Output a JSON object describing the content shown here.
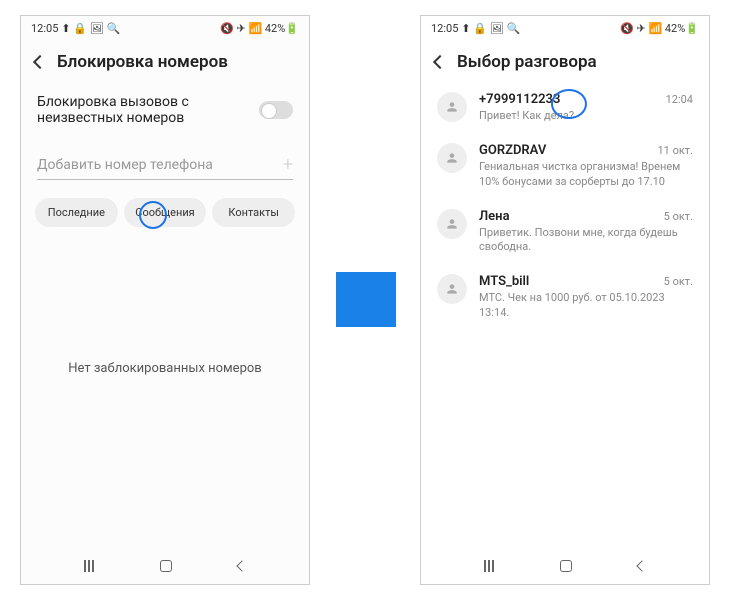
{
  "status": {
    "time": "12:05",
    "left_icons": "⬆ 🔒 🖼 🔍",
    "right_icons": "🔇 ✈ 📶 42%🔋"
  },
  "left": {
    "title": "Блокировка номеров",
    "toggle_label_1": "Блокировка вызовов с",
    "toggle_label_2": "неизвестных номеров",
    "input_placeholder": "Добавить номер телефона",
    "chips": {
      "recent": "Последние",
      "messages": "Сообщения",
      "contacts": "Контакты"
    },
    "empty": "Нет заблокированных номеров"
  },
  "right": {
    "title": "Выбор разговора",
    "items": [
      {
        "name": "+7999112233",
        "preview": "Привет! Как дела?",
        "time": "12:04"
      },
      {
        "name": "GORZDRAV",
        "preview": "Гениальная чистка организма! Вренем 10% бонусами за сорберты до 17.10",
        "time": "11 окт."
      },
      {
        "name": "Лена",
        "preview": "Приветик. Позвони мне, когда будешь свободна.",
        "time": "5 окт."
      },
      {
        "name": "MTS_bill",
        "preview": "МТС. Чек на 1000 руб. от 05.10.2023 13:14.",
        "time": "5 окт."
      }
    ]
  }
}
